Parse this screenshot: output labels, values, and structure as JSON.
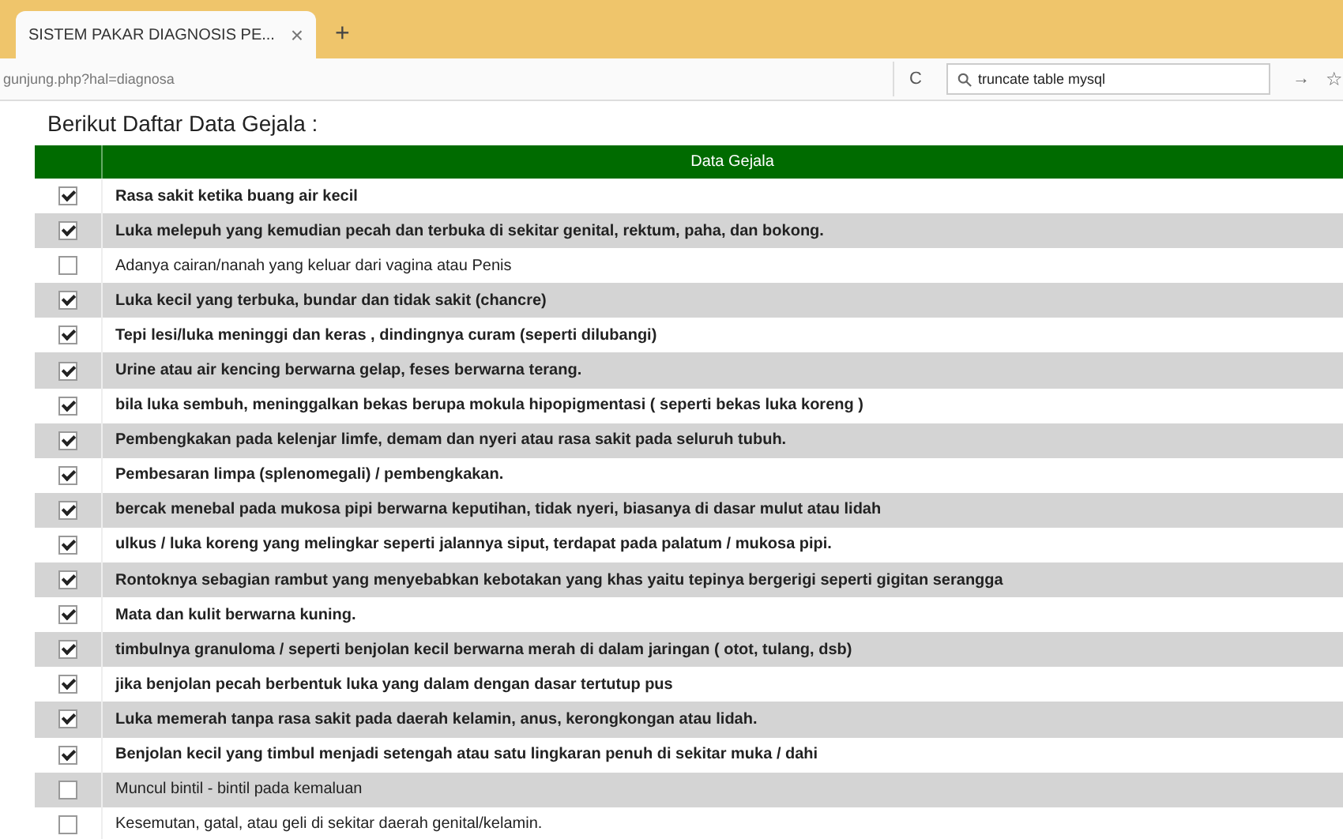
{
  "browser": {
    "tab_title": "SISTEM PAKAR DIAGNOSIS PE...",
    "tab_close": "×",
    "new_tab": "+",
    "url": "gunjung.php?hal=diagnosa",
    "reload": "C",
    "search_value": "truncate table mysql",
    "go": "→",
    "bookmark": "☆"
  },
  "heading": "Berikut Daftar Data Gejala :",
  "table": {
    "columns": [
      "Data Gejala"
    ],
    "rows": [
      {
        "text": "Rasa sakit ketika buang air kecil",
        "checked": true
      },
      {
        "text": "Luka melepuh yang kemudian pecah dan terbuka di sekitar genital, rektum, paha, dan bokong.",
        "checked": true
      },
      {
        "text": "Adanya cairan/nanah yang keluar dari vagina atau Penis",
        "checked": false
      },
      {
        "text": "Luka kecil yang terbuka, bundar dan tidak sakit  (chancre)",
        "checked": true
      },
      {
        "text": "Tepi lesi/luka meninggi dan keras , dindingnya curam (seperti dilubangi)",
        "checked": true
      },
      {
        "text": "Urine atau air kencing berwarna gelap, feses berwarna terang.",
        "checked": true
      },
      {
        "text": "bila luka sembuh, meninggalkan bekas berupa mokula hipopigmentasi ( seperti bekas luka koreng )",
        "checked": true
      },
      {
        "text": "Pembengkakan pada kelenjar limfe, demam dan nyeri atau rasa sakit pada seluruh tubuh.",
        "checked": true
      },
      {
        "text": "Pembesaran limpa (splenomegali) / pembengkakan.",
        "checked": true
      },
      {
        "text": "bercak menebal pada mukosa pipi berwarna keputihan, tidak nyeri, biasanya di dasar mulut atau lidah",
        "checked": true
      },
      {
        "text": "ulkus / luka koreng yang melingkar seperti jalannya siput, terdapat pada palatum / mukosa pipi.",
        "checked": true
      },
      {
        "text": "Rontoknya sebagian rambut yang menyebabkan kebotakan yang khas yaitu tepinya bergerigi seperti gigitan serangga",
        "checked": true
      },
      {
        "text": "Mata dan kulit berwarna kuning.",
        "checked": true
      },
      {
        "text": "timbulnya granuloma / seperti benjolan kecil berwarna merah di dalam jaringan ( otot, tulang, dsb)",
        "checked": true
      },
      {
        "text": "jika benjolan pecah berbentuk luka yang dalam dengan dasar tertutup pus",
        "checked": true
      },
      {
        "text": "Luka memerah tanpa rasa sakit pada daerah kelamin, anus, kerongkongan atau lidah.",
        "checked": true
      },
      {
        "text": "Benjolan kecil yang timbul menjadi setengah atau satu lingkaran penuh di sekitar muka / dahi",
        "checked": true
      },
      {
        "text": "Muncul bintil - bintil pada kemaluan",
        "checked": false
      },
      {
        "text": "Kesemutan, gatal, atau geli di sekitar daerah genital/kelamin.",
        "checked": false
      }
    ]
  }
}
